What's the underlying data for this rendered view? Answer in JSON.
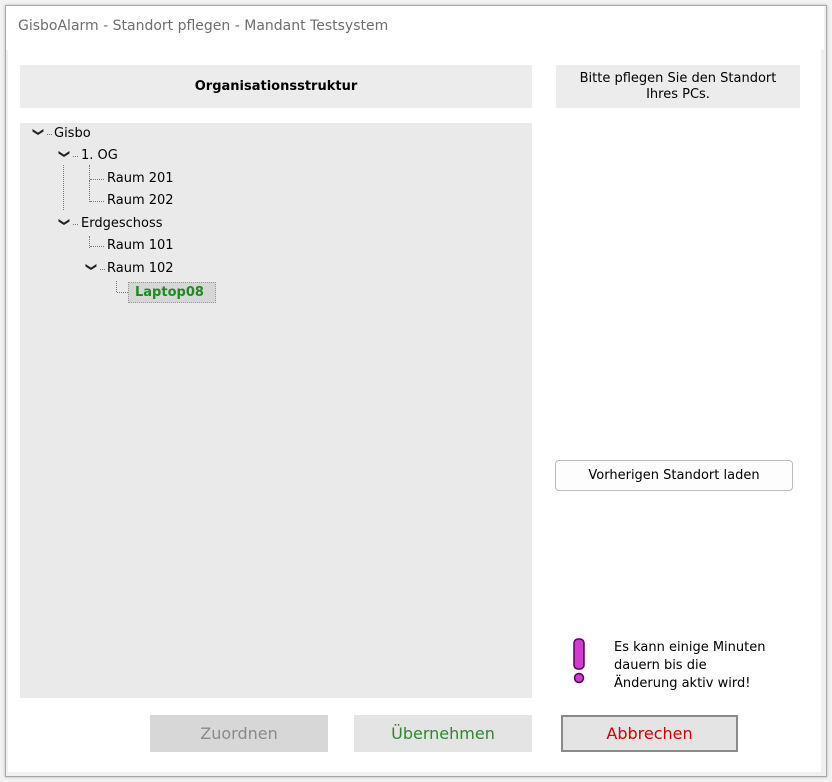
{
  "window": {
    "title": "GisboAlarm - Standort pflegen - Mandant Testsystem"
  },
  "tree_panel": {
    "header": "Organisationsstruktur",
    "nodes": [
      {
        "label": "Gisbo",
        "level": 0,
        "expanded": true
      },
      {
        "label": "1. OG",
        "level": 1,
        "expanded": true
      },
      {
        "label": "Raum 201",
        "level": 2
      },
      {
        "label": "Raum 202",
        "level": 2
      },
      {
        "label": "Erdgeschoss",
        "level": 1,
        "expanded": true
      },
      {
        "label": "Raum 101",
        "level": 2
      },
      {
        "label": "Raum 102",
        "level": 2,
        "expanded": true
      },
      {
        "label": "Laptop08",
        "level": 3,
        "selected": true
      }
    ]
  },
  "side_panel": {
    "hint": "Bitte pflegen Sie den Standort Ihres PCs.",
    "load_previous_button": "Vorherigen Standort laden",
    "warning_icon": "exclamation-icon",
    "warning_text": "Es kann einige Minuten\ndauern bis die\nÄnderung aktiv wird!"
  },
  "buttons": {
    "assign": "Zuordnen",
    "apply": "Übernehmen",
    "cancel": "Abbrechen"
  },
  "colors": {
    "selected_text": "#1f8a1f",
    "apply_text": "#2a8a2a",
    "cancel_text": "#d20000",
    "disabled_text": "#8a8a8a",
    "warning_icon": "#c020c0"
  }
}
